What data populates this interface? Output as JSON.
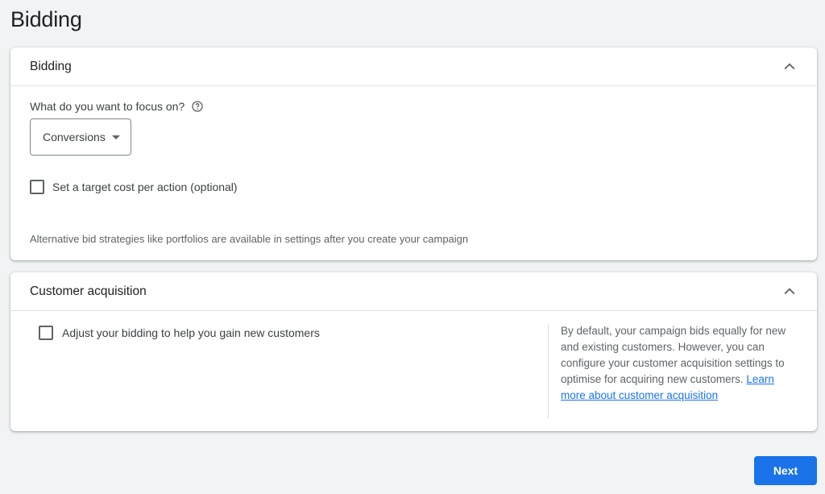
{
  "page": {
    "title": "Bidding"
  },
  "bidding_card": {
    "title": "Bidding",
    "focus_label": "What do you want to focus on?",
    "focus_select": {
      "selected": "Conversions"
    },
    "target_cpa_checkbox": {
      "label": "Set a target cost per action (optional)",
      "checked": false
    },
    "note": "Alternative bid strategies like portfolios are available in settings after you create your campaign"
  },
  "acquisition_card": {
    "title": "Customer acquisition",
    "new_customers_checkbox": {
      "label": "Adjust your bidding to help you gain new customers",
      "checked": false
    },
    "info_text": "By default, your campaign bids equally for new and existing customers. However, you can configure your customer acquisition settings to optimise for acquiring new customers.",
    "learn_more_link": "Learn more about customer acquisition"
  },
  "footer": {
    "next_label": "Next"
  },
  "colors": {
    "accent": "#1a73e8",
    "background": "#f1f3f4"
  },
  "icons": {
    "collapse": "chevron-up-icon",
    "help": "help-circle-icon",
    "dropdown": "caret-down-icon"
  }
}
